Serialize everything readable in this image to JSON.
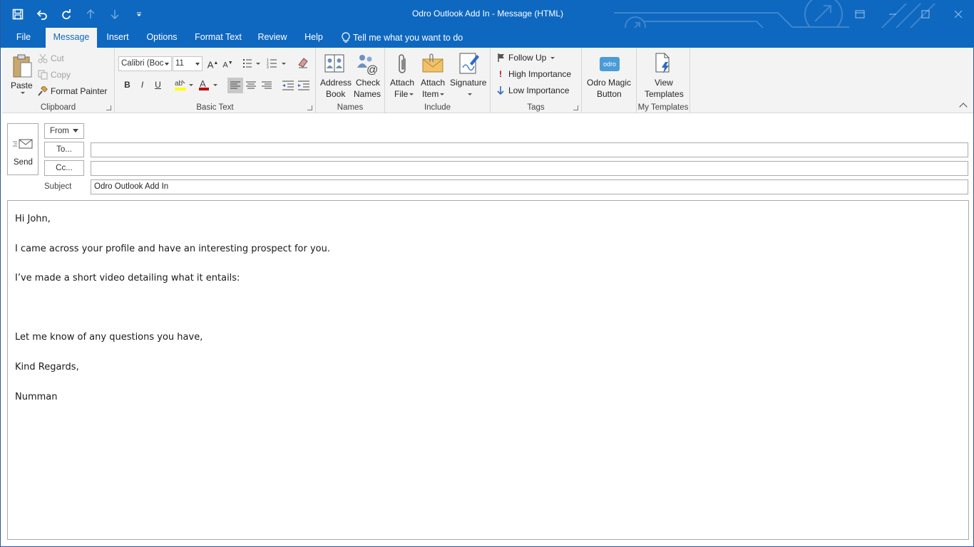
{
  "window": {
    "title": "Odro Outlook Add In  -  Message (HTML)",
    "accent": "#0e68c0"
  },
  "quick_access": {
    "icons": [
      "save-icon",
      "undo-icon",
      "redo-icon",
      "up-arrow-icon",
      "down-arrow-icon",
      "customize-icon"
    ]
  },
  "tabs": [
    {
      "label": "File"
    },
    {
      "label": "Message",
      "active": true
    },
    {
      "label": "Insert"
    },
    {
      "label": "Options"
    },
    {
      "label": "Format Text"
    },
    {
      "label": "Review"
    },
    {
      "label": "Help"
    }
  ],
  "tell_me": "Tell me what you want to do",
  "ribbon": {
    "clipboard": {
      "label": "Clipboard",
      "paste": "Paste",
      "cut": "Cut",
      "copy": "Copy",
      "format_painter": "Format Painter"
    },
    "basic_text": {
      "label": "Basic Text",
      "font": "Calibri (Boc",
      "size": "11",
      "bold": "B",
      "italic": "I",
      "underline": "U"
    },
    "names": {
      "label": "Names",
      "address_book": [
        "Address",
        "Book"
      ],
      "check_names": [
        "Check",
        "Names"
      ]
    },
    "include": {
      "label": "Include",
      "attach_file": [
        "Attach",
        "File"
      ],
      "attach_item": [
        "Attach",
        "Item"
      ],
      "signature": "Signature"
    },
    "tags": {
      "label": "Tags",
      "follow_up": "Follow Up",
      "high": "High Importance",
      "low": "Low Importance"
    },
    "odro": {
      "label": [
        "Odro Magic",
        "Button"
      ],
      "logo": "odro"
    },
    "templates": {
      "label": "My Templates",
      "view": [
        "View",
        "Templates"
      ]
    }
  },
  "compose": {
    "send": "Send",
    "from": "From",
    "to": "To...",
    "cc": "Cc...",
    "subject_label": "Subject",
    "to_value": "",
    "cc_value": "",
    "subject_value": "Odro Outlook Add In"
  },
  "body": {
    "lines": [
      "Hi John,",
      "I came across your profile and have an interesting prospect for you.",
      "I’ve made a short video detailing what it entails:",
      "Let me know of any questions you have,",
      "Kind Regards,",
      "Numman"
    ]
  }
}
